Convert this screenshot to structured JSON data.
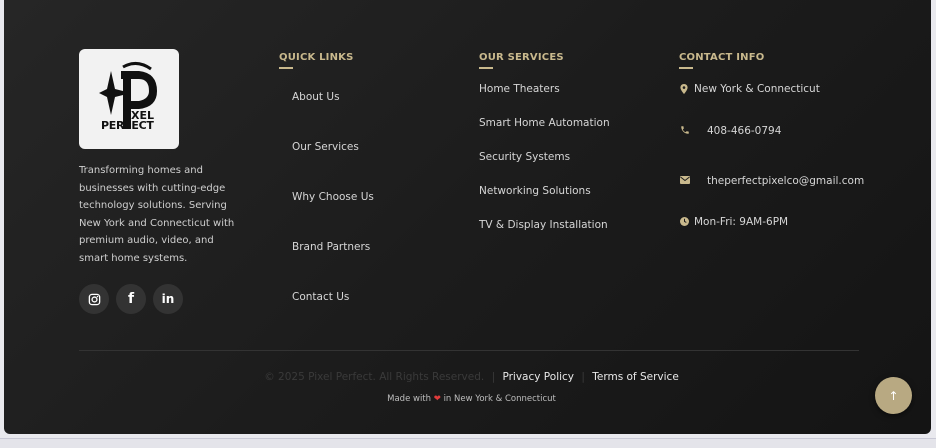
{
  "brand": {
    "logo_line1": "XEL",
    "logo_line2": "PERFECT",
    "description": "Transforming homes and businesses with cutting-edge technology solutions. Serving New York and Connecticut with premium audio, video, and smart home systems."
  },
  "social": [
    {
      "name": "instagram",
      "icon": "instagram-icon"
    },
    {
      "name": "facebook",
      "icon": "facebook-icon",
      "glyph": "f"
    },
    {
      "name": "linkedin",
      "icon": "linkedin-icon",
      "glyph": "in"
    }
  ],
  "quick_links": {
    "title": "QUICK LINKS",
    "items": [
      "About Us",
      "Our Services",
      "Why Choose Us",
      "Brand Partners",
      "Contact Us"
    ]
  },
  "services": {
    "title": "OUR SERVICES",
    "items": [
      "Home Theaters",
      "Smart Home Automation",
      "Security Systems",
      "Networking Solutions",
      "TV & Display Installation"
    ]
  },
  "contact": {
    "title": "CONTACT INFO",
    "location": "New York & Connecticut",
    "phone": "408-466-0794",
    "email": "theperfectpixelco@gmail.com",
    "hours": "Mon-Fri: 9AM-6PM"
  },
  "bottom": {
    "copyright": "© 2025 Pixel Perfect. All Rights Reserved.",
    "privacy": "Privacy Policy",
    "terms": "Terms of Service",
    "separator": "|",
    "made_prefix": "Made with",
    "heart": "❤",
    "made_suffix": "in New York & Connecticut"
  },
  "scroll_top": {
    "glyph": "↑"
  },
  "colors": {
    "accent": "#c9b98d",
    "background": "#1c1c1c",
    "heart": "#e03b3b"
  }
}
